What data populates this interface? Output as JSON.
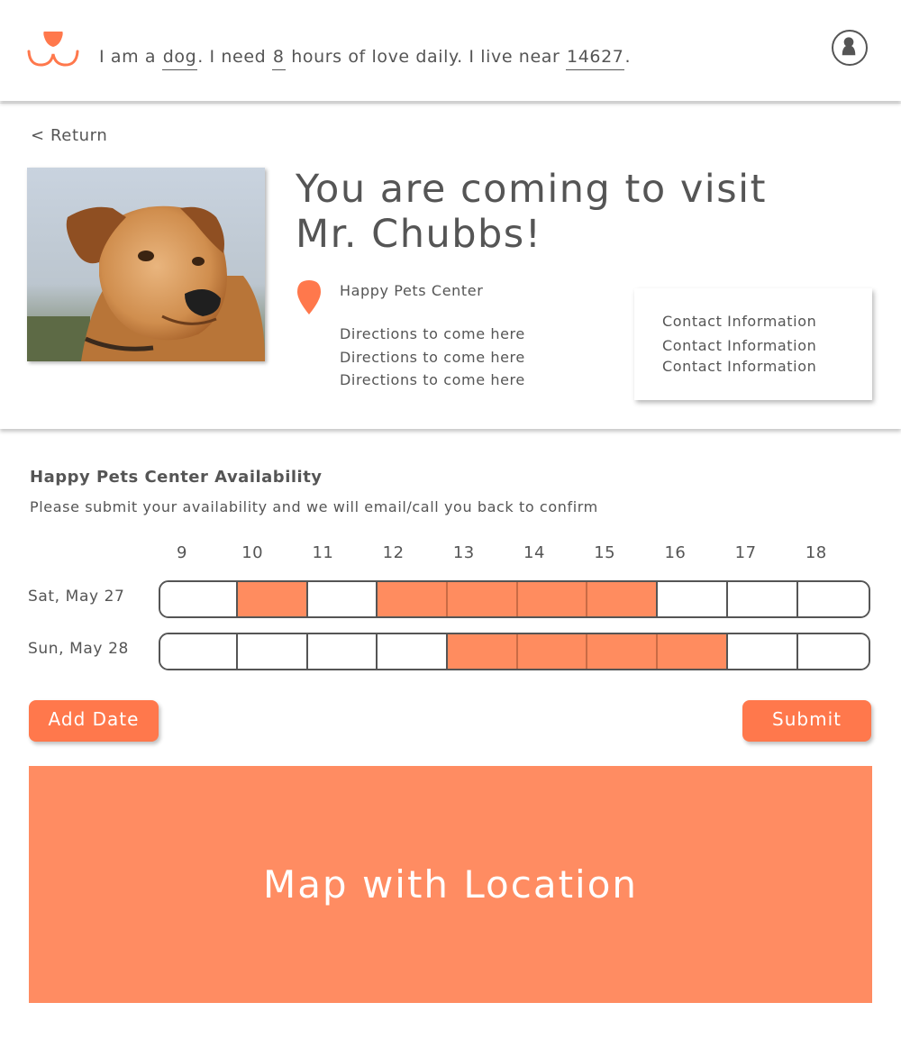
{
  "header": {
    "sentence": {
      "part1": "I am a ",
      "animal": "dog",
      "part2": ". I need ",
      "hours": "8",
      "part3": " hours of love daily. I live near ",
      "zip": "14627",
      "part4": "."
    },
    "logo_icon": "paw-smile-logo-icon",
    "avatar_icon": "user-icon"
  },
  "card": {
    "return_label": "< Return",
    "title": "You are coming to visit Mr. Chubbs!",
    "location_icon": "map-pin-icon",
    "center_name": "Happy Pets Center",
    "directions": [
      "Directions to come here",
      "Directions to come here",
      "Directions to come here"
    ],
    "contact": [
      "Contact Information",
      "Contact Information",
      "Contact Information"
    ]
  },
  "availability": {
    "title": "Happy Pets Center Availability",
    "subtitle": "Please submit your availability and we will email/call you back to confirm",
    "hours": [
      "9",
      "10",
      "11",
      "12",
      "13",
      "14",
      "15",
      "16",
      "17",
      "18"
    ],
    "days": [
      {
        "label": "Sat, May 27",
        "selected": [
          false,
          true,
          false,
          true,
          true,
          true,
          true,
          false,
          false,
          false
        ]
      },
      {
        "label": "Sun, May 28",
        "selected": [
          false,
          false,
          false,
          false,
          true,
          true,
          true,
          true,
          false,
          false
        ]
      }
    ],
    "add_date_label": "Add Date",
    "submit_label": "Submit"
  },
  "map": {
    "label": "Map with Location"
  },
  "colors": {
    "accent": "#ff784c",
    "slot_selected": "#ff8c5f",
    "map_bg": "#ff8c62",
    "text": "#555555"
  }
}
